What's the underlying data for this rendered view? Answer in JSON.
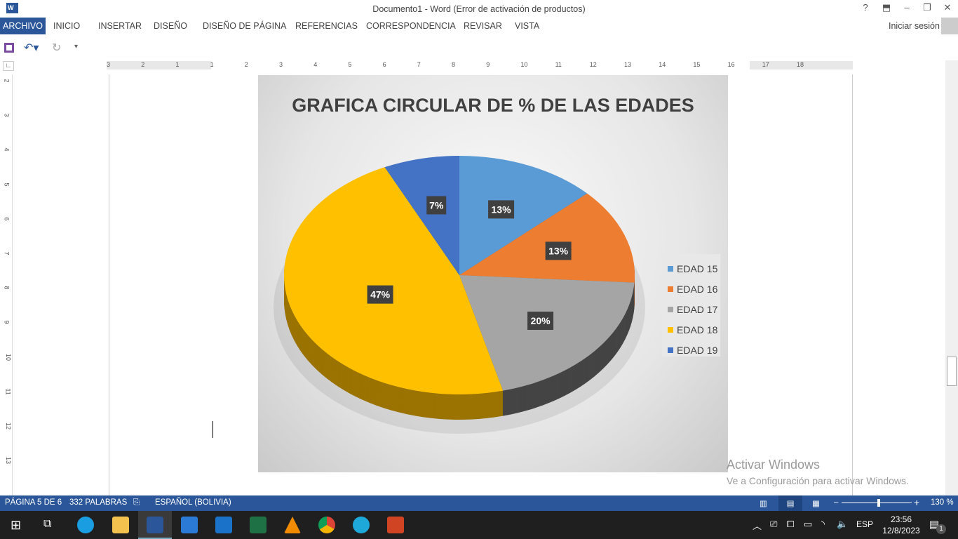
{
  "window": {
    "title": "Documento1 - Word (Error de activación de productos)",
    "help": "?",
    "signin": "Iniciar sesión"
  },
  "tabs": [
    "ARCHIVO",
    "INICIO",
    "INSERTAR",
    "DISEÑO",
    "DISEÑO DE PÁGINA",
    "REFERENCIAS",
    "CORRESPONDENCIA",
    "REVISAR",
    "VISTA"
  ],
  "ruler": {
    "h": [
      "3",
      "2",
      "1",
      "1",
      "2",
      "3",
      "4",
      "5",
      "6",
      "7",
      "8",
      "9",
      "10",
      "11",
      "12",
      "13",
      "14",
      "15",
      "16",
      "17",
      "18"
    ],
    "v": [
      "2",
      "3",
      "4",
      "5",
      "6",
      "7",
      "8",
      "9",
      "10",
      "11",
      "12",
      "13"
    ]
  },
  "chart_data": {
    "type": "pie",
    "title": "GRAFICA CIRCULAR DE % DE LAS EDADES",
    "categories": [
      "EDAD 15",
      "EDAD 16",
      "EDAD 17",
      "EDAD 18",
      "EDAD 19"
    ],
    "values": [
      13,
      13,
      20,
      47,
      7
    ],
    "labels": [
      "13%",
      "13%",
      "20%",
      "47%",
      "7%"
    ],
    "colors": [
      "#5B9BD5",
      "#ED7D31",
      "#A5A5A5",
      "#FFC000",
      "#4472C4"
    ],
    "side_colors": [
      "#3a6f9e",
      "#a9561f",
      "#444444",
      "#9a7300",
      "#2d4f8a"
    ],
    "legend": "right",
    "style": "3d"
  },
  "watermark": {
    "line1": "Activar Windows",
    "line2": "Ve a Configuración para activar Windows."
  },
  "status": {
    "page": "PÁGINA 5 DE 6",
    "words": "332 PALABRAS",
    "language": "ESPAÑOL (BOLIVIA)",
    "zoom": "130 %",
    "zoom_level": 130
  },
  "taskbar": {
    "time": "23:56",
    "date": "12/8/2023",
    "lang": "ESP",
    "notifications": "1"
  }
}
